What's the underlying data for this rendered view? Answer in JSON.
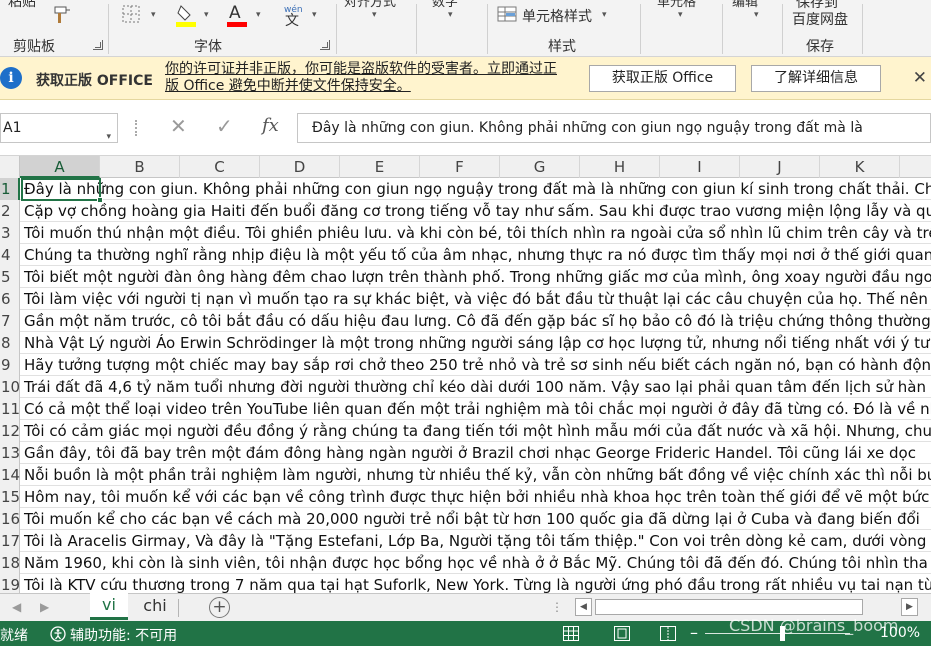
{
  "ribbon": {
    "clipboard_partial_label": "粘贴",
    "paste_top_label": "粘贴",
    "groups": {
      "clipboard": "剪贴板",
      "font": "字体",
      "styles": "样式",
      "save": "保存"
    },
    "partial_labels": [
      "对齐方式",
      "数字"
    ],
    "cell_styles_label": "单元格样式",
    "right_partial_labels": [
      "单元格",
      "编辑"
    ],
    "baidu_save_line1": "保存到",
    "baidu_save_line2": "百度网盘",
    "wen_label": "文",
    "colors": {
      "highlight": "#ffff00",
      "font_color": "#ff0000"
    }
  },
  "infobar": {
    "title": "获取正版 OFFICE",
    "message": "你的许可证并非正版，你可能是盗版软件的受害者。立即通过正版 Office 避免中断并使文件保持安全。",
    "button_get": "获取正版 Office",
    "button_learn": "了解详细信息",
    "close": "✕"
  },
  "formula_bar": {
    "name_box": "A1",
    "cancel_icon": "✕",
    "enter_icon": "✓",
    "fx": "fx",
    "content": "Đây là những con giun. Không phải những con giun ngọ nguậy trong đất mà là"
  },
  "grid": {
    "columns": [
      "A",
      "B",
      "C",
      "D",
      "E",
      "F",
      "G",
      "H",
      "I",
      "J",
      "K"
    ],
    "selected_cell": "A1",
    "rows": [
      {
        "n": "1",
        "text": "Đây là những con giun. Không phải những con giun ngọ nguậy trong đất mà là những con giun kí sinh trong chất thải. Chú"
      },
      {
        "n": "2",
        "text": "Cặp vợ chồng hoàng gia Haiti đến buổi đăng cơ trong tiếng vỗ tay như sấm. Sau khi được trao vương miện lộng lẫy và qu"
      },
      {
        "n": "3",
        "text": "Tôi muốn thú nhận một điều. Tôi ghiền phiêu lưu. và khi còn bé, tôi thích nhìn ra ngoài cửa sổ nhìn lũ chim trên cây và trê"
      },
      {
        "n": "4",
        "text": "Chúng ta thường nghĩ rằng nhịp điệu là một yếu tố của âm nhạc, nhưng thực ra nó được tìm thấy mọi nơi ở thế giới quan"
      },
      {
        "n": "5",
        "text": "Tôi biết một người đàn ông hàng đêm chao lượn trên thành phố. Trong những giấc mơ của mình, ông xoay người đầu ngo"
      },
      {
        "n": "6",
        "text": "Tôi làm việc với người tị nạn vì muốn tạo ra sự khác biệt, và việc đó bắt đầu từ thuật lại các câu chuyện của họ. Thế nên k"
      },
      {
        "n": "7",
        "text": "Gần một năm trước, cô tôi bắt đầu có dấu hiệu đau lưng. Cô đã đến gặp bác sĩ  họ bảo cô đó là triệu chứng thông thường"
      },
      {
        "n": "8",
        "text": "Nhà Vật Lý người Áo Erwin Schrödinger là một trong những người sáng lập cơ học lượng tử, nhưng nổi tiếng nhất với ý tư"
      },
      {
        "n": "9",
        "text": "Hãy tưởng tượng một chiếc may bay sắp rơi chở theo 250 trẻ nhỏ và trẻ sơ sinh nếu biết cách ngăn nó, bạn có hành độn"
      },
      {
        "n": "10",
        "text": "Trái đất đã 4,6 tỷ năm tuổi nhưng đời người thường chỉ kéo dài dưới 100 năm. Vậy sao lại phải quan tâm đến lịch sử hàn"
      },
      {
        "n": "11",
        "text": "Có cả một thể loại video trên YouTube liên quan đến một trải nghiệm mà tôi chắc mọi người ở đây đã từng có. Đó là về nhữ"
      },
      {
        "n": "12",
        "text": "Tôi có cảm giác mọi người đều đồng ý rằng chúng ta đang tiến tới một hình mẫu mới của đất nước và xã hội. Nhưng, chu"
      },
      {
        "n": "13",
        "text": "Gần đây, tôi đã bay trên một đám đông hàng ngàn người ở Brazil chơi nhạc George Frideric Handel. Tôi cũng lái xe dọc"
      },
      {
        "n": "14",
        "text": "Nỗi buồn là một phần trải nghiệm làm người, nhưng từ nhiều thế kỷ, vẫn còn những bất đồng về việc chính xác thì nỗi buồ"
      },
      {
        "n": "15",
        "text": "Hôm nay, tôi muốn kể với các bạn về công trình được thực hiện bởi nhiều nhà khoa học trên toàn thế giới để vẽ một bức"
      },
      {
        "n": "16",
        "text": "Tôi muốn kể cho các bạn về cách mà 20,000 người trẻ nổi bật từ hơn 100 quốc gia đã dừng lại ở Cuba và đang biến đổi"
      },
      {
        "n": "17",
        "text": "Tôi là Aracelis Girmay, Và đây là \"Tặng Estefani, Lớp Ba, Người tặng tôi tấm thiệp.\" Con voi trên dòng kẻ cam, dưới vòng"
      },
      {
        "n": "18",
        "text": "Năm 1960, khi còn là sinh viên, tôi nhận được học bổng  học về nhà ở ở Bắc Mỹ. Chúng tôi đã đến đó. Chúng tôi nhìn tha"
      },
      {
        "n": "19",
        "text": "Tôi là KTV cứu thương trong 7 năm qua tại hạt Suforlk, New York. Từng là người ứng phó đầu trong rất nhiều vụ tai nạn từ"
      }
    ]
  },
  "tabs": {
    "sheets": [
      "vi",
      "chi"
    ],
    "active": "vi",
    "add": "+"
  },
  "status": {
    "ready": "就绪",
    "accessibility": "辅助功能: 不可用",
    "zoom": "100%",
    "watermark": "CSDN @brains_boom"
  }
}
